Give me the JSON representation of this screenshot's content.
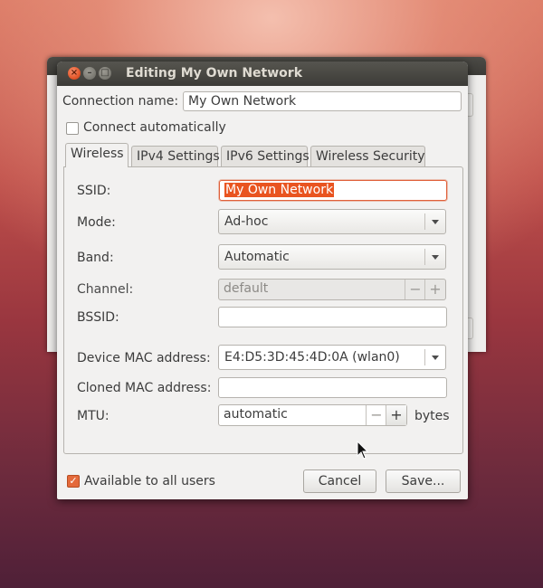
{
  "window": {
    "title": "Editing My Own Network",
    "close_glyph": "×",
    "min_glyph": "–",
    "max_glyph": "□"
  },
  "connection": {
    "name_label": "Connection name:",
    "name_value": "My Own Network",
    "auto_connect_label": "Connect automatically",
    "auto_connect_checked": false
  },
  "tabs": [
    {
      "label": "Wireless",
      "active": true
    },
    {
      "label": "IPv4 Settings",
      "active": false
    },
    {
      "label": "IPv6 Settings",
      "active": false
    },
    {
      "label": "Wireless Security",
      "active": false
    }
  ],
  "wireless": {
    "ssid_label": "SSID:",
    "ssid_value": "My Own Network",
    "mode_label": "Mode:",
    "mode_value": "Ad-hoc",
    "band_label": "Band:",
    "band_value": "Automatic",
    "channel_label": "Channel:",
    "channel_value": "default",
    "bssid_label": "BSSID:",
    "bssid_value": "",
    "device_mac_label": "Device MAC address:",
    "device_mac_value": "E4:D5:3D:45:4D:0A (wlan0)",
    "cloned_mac_label": "Cloned MAC address:",
    "cloned_mac_value": "",
    "mtu_label": "MTU:",
    "mtu_value": "automatic",
    "mtu_unit": "bytes",
    "minus_glyph": "−",
    "plus_glyph": "+"
  },
  "footer": {
    "all_users_label": "Available to all users",
    "all_users_checked": true,
    "check_glyph": "✓",
    "cancel_label": "Cancel",
    "save_label": "Save..."
  },
  "colors": {
    "accent": "#e95420",
    "titlebar": "#3c3b37"
  }
}
